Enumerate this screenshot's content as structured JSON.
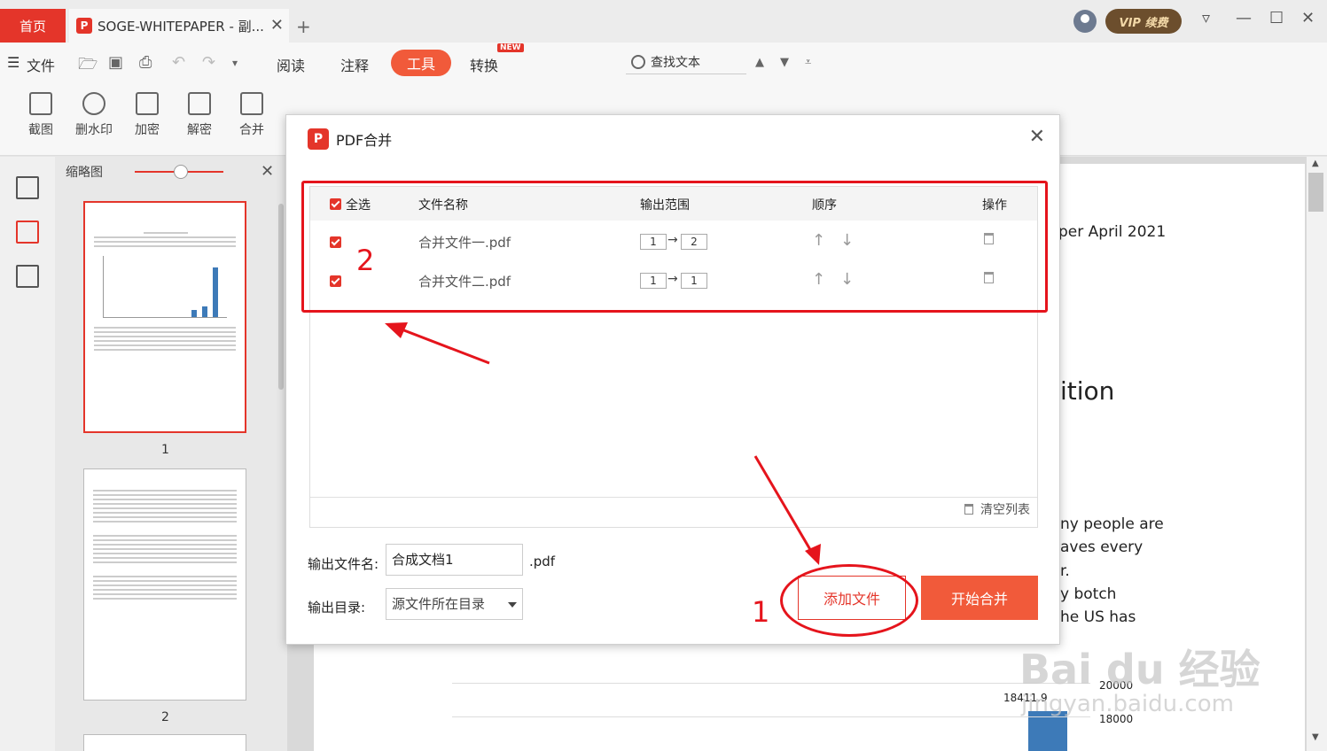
{
  "titlebar": {
    "home_tab": "首页",
    "doc_tab": "SOGE-WHITEPAPER - 副...",
    "vip_label": "VIP 续费"
  },
  "menubar": {
    "file": "文件",
    "read": "阅读",
    "annotate": "注释",
    "tools": "工具",
    "convert": "转换",
    "new_badge": "NEW",
    "search_text": "查找文本"
  },
  "toolbar": {
    "tools": [
      "截图",
      "删水印",
      "加密",
      "解密",
      "合并"
    ]
  },
  "thumbnails": {
    "label": "缩略图",
    "pages": [
      "1",
      "2"
    ]
  },
  "document": {
    "line1": "per April 2021",
    "line2": "ition",
    "line3": "ny people are",
    "line4": "aves every",
    "line5": "r.",
    "line6": "y botch",
    "line7": "he US has",
    "chart_tick1": "20000",
    "chart_tick2": "18000",
    "chart_value": "18411.9"
  },
  "dialog": {
    "title": "PDF合并",
    "headers": {
      "select_all": "全选",
      "file_name": "文件名称",
      "output_range": "输出范围",
      "order": "顺序",
      "action": "操作"
    },
    "rows": [
      {
        "name": "合并文件一.pdf",
        "from": "1",
        "to": "2"
      },
      {
        "name": "合并文件二.pdf",
        "from": "1",
        "to": "1"
      }
    ],
    "clear_list": "清空列表",
    "output_name_label": "输出文件名:",
    "output_name_value": "合成文档1",
    "output_ext": ".pdf",
    "output_dir_label": "输出目录:",
    "output_dir_value": "源文件所在目录",
    "add_file": "添加文件",
    "start_merge": "开始合并"
  },
  "annotations": {
    "num1": "1",
    "num2": "2",
    "color": "#e5141c"
  },
  "watermark": {
    "main": "Bai du 经验",
    "sub": "jingyan.baidu.com"
  },
  "colors": {
    "accent": "#e4352a",
    "button": "#f15a3a"
  }
}
